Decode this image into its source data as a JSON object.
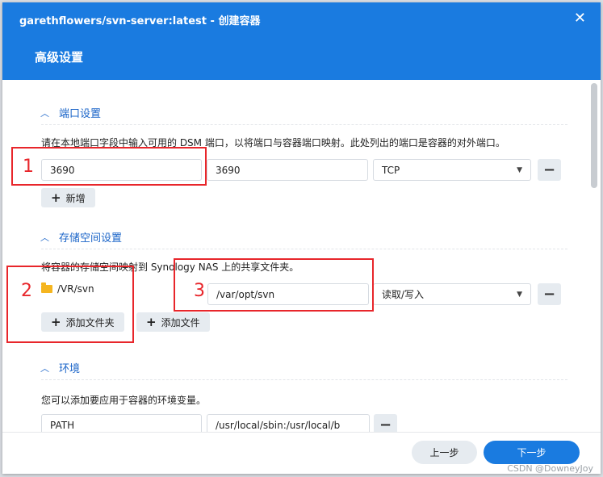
{
  "window": {
    "title": "garethflowers/svn-server:latest - 创建容器",
    "subtitle": "高级设置"
  },
  "ports": {
    "section_title": "端口设置",
    "description": "请在本地端口字段中输入可用的 DSM 端口，以将端口与容器端口映射。此处列出的端口是容器的对外端口。",
    "local_port": "3690",
    "container_port": "3690",
    "protocol": "TCP",
    "add_label": "新增"
  },
  "storage": {
    "section_title": "存储空间设置",
    "description": "将容器的存储空间映射到 Synology NAS 上的共享文件夹。",
    "folder": "/VR/svn",
    "mount_path": "/var/opt/svn",
    "permission": "读取/写入",
    "add_folder_label": "添加文件夹",
    "add_file_label": "添加文件"
  },
  "env": {
    "section_title": "环境",
    "description": "您可以添加要应用于容器的环境变量。",
    "var_name": "PATH",
    "var_value": "/usr/local/sbin:/usr/local/b"
  },
  "footer": {
    "prev_label": "上一步",
    "next_label": "下一步"
  },
  "annotations": [
    "1",
    "2",
    "3"
  ],
  "watermark": "CSDN @DowneyJoy",
  "colors": {
    "header": "#1a7be0",
    "accent": "#1a64c8",
    "annotation": "#e8262b"
  }
}
